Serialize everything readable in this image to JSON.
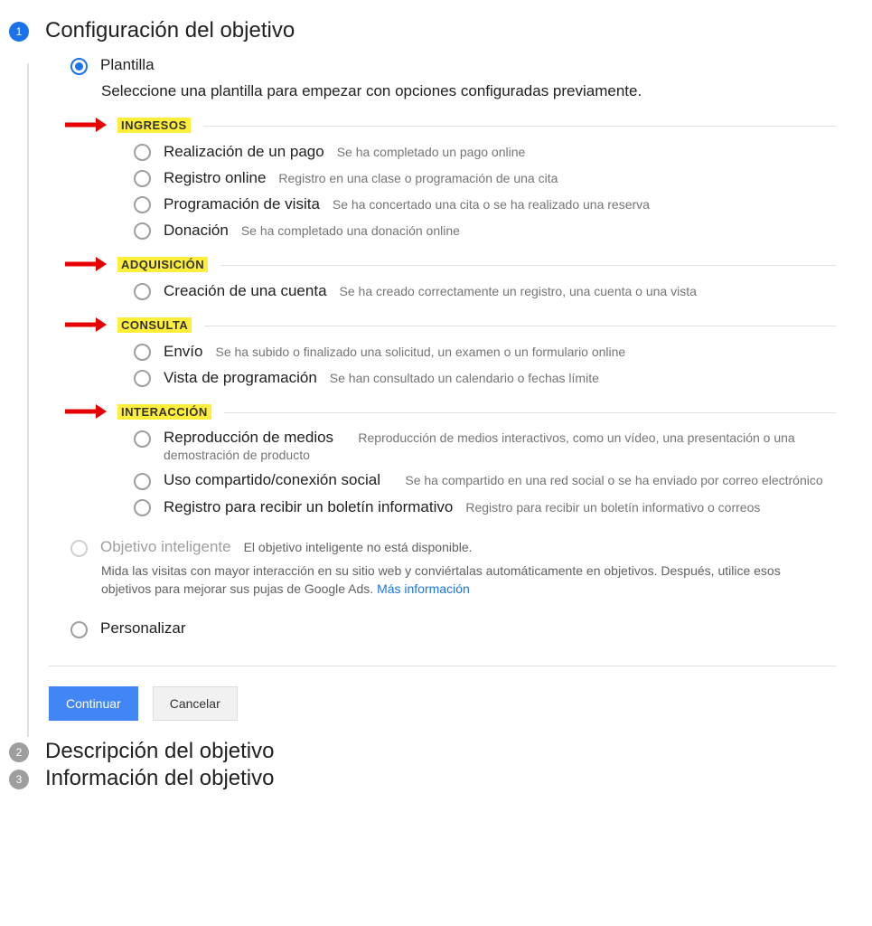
{
  "steps": {
    "s1_num": "1",
    "s1_title": "Configuración del objetivo",
    "s2_num": "2",
    "s2_title": "Descripción del objetivo",
    "s3_num": "3",
    "s3_title": "Información del objetivo"
  },
  "top": {
    "template_label": "Plantilla",
    "template_help": "Seleccione una plantilla para empezar con opciones configuradas previamente."
  },
  "categories": {
    "ingresos": "INGRESOS",
    "adquisicion": "ADQUISICIÓN",
    "consulta": "CONSULTA",
    "interaccion": "INTERACCIÓN"
  },
  "options": {
    "pago_t": "Realización de un pago",
    "pago_d": "Se ha completado un pago online",
    "registro_t": "Registro online",
    "registro_d": "Registro en una clase o programación de una cita",
    "visita_t": "Programación de visita",
    "visita_d": "Se ha concertado una cita o se ha realizado una reserva",
    "donacion_t": "Donación",
    "donacion_d": "Se ha completado una donación online",
    "cuenta_t": "Creación de una cuenta",
    "cuenta_d": "Se ha creado correctamente un registro, una cuenta o una vista",
    "envio_t": "Envío",
    "envio_d": "Se ha subido o finalizado una solicitud, un examen o un formulario online",
    "vista_t": "Vista de programación",
    "vista_d": "Se han consultado un calendario o fechas límite",
    "medios_t": "Reproducción de medios",
    "medios_d": "Reproducción de medios interactivos, como un vídeo, una presentación o una demostración de producto",
    "social_t": "Uso compartido/conexión social",
    "social_d": "Se ha compartido en una red social o se ha enviado por correo electrónico",
    "boletin_t": "Registro para recibir un boletín informativo",
    "boletin_d": "Registro para recibir un boletín informativo o correos"
  },
  "smart": {
    "title": "Objetivo inteligente",
    "unavailable": "El objetivo inteligente no está disponible.",
    "help": "Mida las visitas con mayor interacción en su sitio web y conviértalas automáticamente en objetivos. Después, utilice esos objetivos para mejorar sus pujas de Google Ads. ",
    "link": "Más información"
  },
  "custom_label": "Personalizar",
  "buttons": {
    "continue": "Continuar",
    "cancel": "Cancelar"
  }
}
